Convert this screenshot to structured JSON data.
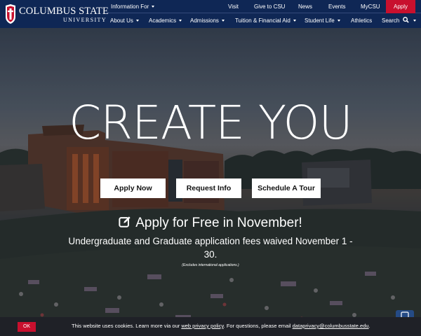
{
  "logo": {
    "name_line1": "Columbus State",
    "name_line2": "UNIVERSITY"
  },
  "top_nav": {
    "information_for": "Information For",
    "visit": "Visit",
    "give": "Give to CSU",
    "news": "News",
    "events": "Events",
    "mycsu": "MyCSU",
    "apply": "Apply"
  },
  "main_nav": {
    "about": "About Us",
    "academics": "Academics",
    "admissions": "Admissions",
    "tuition": "Tuition & Financial Aid",
    "student_life": "Student Life",
    "athletics": "Athletics",
    "search": "Search"
  },
  "hero": {
    "headline": "CREATE YOU",
    "buttons": {
      "apply": "Apply Now",
      "info": "Request Info",
      "tour": "Schedule A Tour"
    },
    "promo_title": "Apply for Free in November!",
    "promo_subtitle": "Undergraduate and Graduate application fees waived November 1 - 30.",
    "promo_note": "(Excludes international applications.)"
  },
  "cookie": {
    "ok_label": "OK",
    "text_prefix": "This website uses cookies. Learn more via our",
    "privacy_link": "web privacy policy",
    "text_middle": ". For questions, please email",
    "email_link": "dataprivacy@columbusstate.edu",
    "text_suffix": "."
  },
  "colors": {
    "navy": "#0f2755",
    "red": "#c8102e",
    "white": "#ffffff"
  },
  "icons": {
    "edit": "edit-square-icon",
    "search": "search-icon",
    "caret": "caret-down-icon",
    "chat": "chat-icon"
  }
}
